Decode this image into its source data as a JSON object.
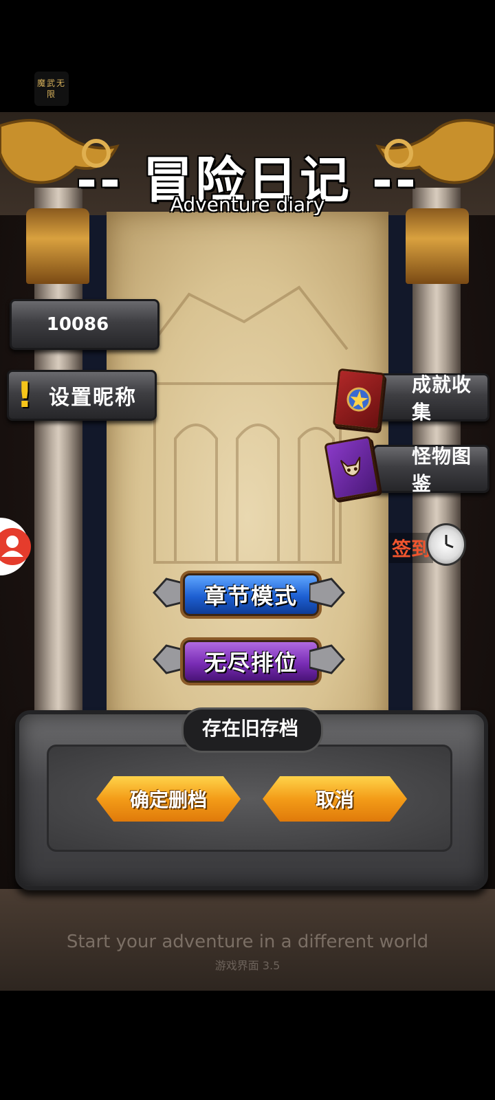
{
  "app_icon": {
    "text": "魔武无限"
  },
  "header": {
    "title": "-- 冒险日记 --",
    "subtitle": "Adventure diary"
  },
  "player": {
    "id": "10086",
    "nickname_button": "设置昵称"
  },
  "side_menu": {
    "achievements": "成就收集",
    "monster_guide": "怪物图鉴",
    "sign_in": "签到"
  },
  "modes": {
    "chapter": "章节模式",
    "endless": "无尽排位"
  },
  "dialog": {
    "title": "存在旧存档",
    "confirm": "确定删档",
    "cancel": "取消"
  },
  "footer": {
    "tagline": "Start your adventure in a different world",
    "version": "游戏界面 3.5"
  },
  "colors": {
    "sign_in": "#f1552e",
    "chapter_button": "#1d5fd2",
    "endless_button": "#7a2db6",
    "dialog_button": "#f39c18",
    "alert_icon": "#f6c51a",
    "avatar_button": "#e53c2c"
  }
}
